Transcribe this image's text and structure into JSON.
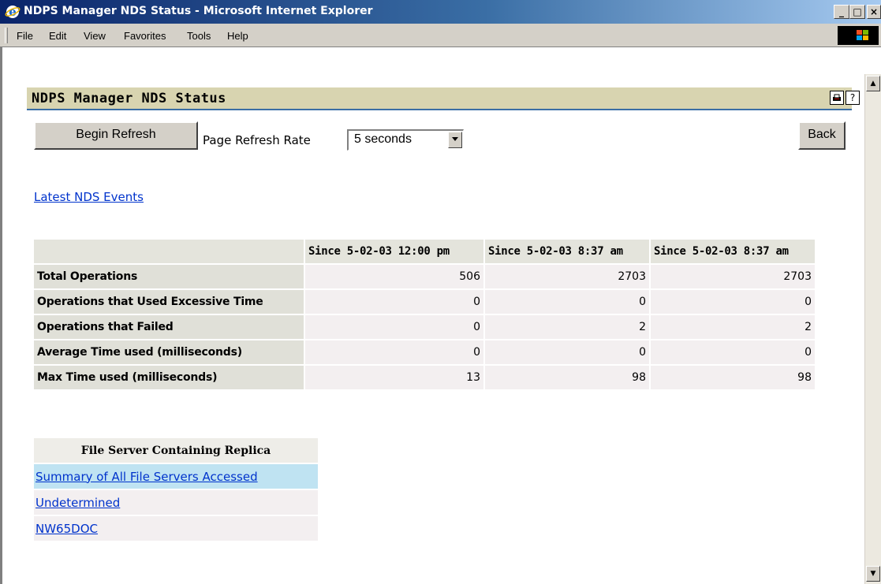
{
  "window": {
    "title": "NDPS Manager NDS Status - Microsoft Internet Explorer",
    "controls": {
      "minimize": "_",
      "maximize": "□",
      "close": "×"
    }
  },
  "menu": {
    "items": [
      "File",
      "Edit",
      "View",
      "Favorites",
      "Tools",
      "Help"
    ]
  },
  "header": {
    "title": "NDPS Manager NDS Status",
    "print_icon": "printer-icon",
    "help_icon": "help-icon"
  },
  "controls": {
    "begin_refresh": "Begin Refresh",
    "refresh_rate_label": "Page Refresh Rate",
    "refresh_rate_value": "5 seconds",
    "back": "Back"
  },
  "latest_link": "Latest NDS Events",
  "stats_table": {
    "columns": [
      "Since 5-02-03 12:00 pm",
      "Since 5-02-03 8:37 am",
      "Since 5-02-03 8:37 am"
    ],
    "rows": [
      {
        "label": "Total Operations",
        "values": [
          "506",
          "2703",
          "2703"
        ]
      },
      {
        "label": "Operations that Used Excessive Time",
        "values": [
          "0",
          "0",
          "0"
        ]
      },
      {
        "label": "Operations that Failed",
        "values": [
          "0",
          "2",
          "2"
        ]
      },
      {
        "label": "Average Time used (milliseconds)",
        "values": [
          "0",
          "0",
          "0"
        ]
      },
      {
        "label": "Max Time used (milliseconds)",
        "values": [
          "13",
          "98",
          "98"
        ]
      }
    ]
  },
  "servers_table": {
    "header": "File Server Containing Replica",
    "rows": [
      "Summary of All File Servers Accessed",
      "Undetermined",
      "NW65DOC"
    ]
  },
  "colors": {
    "title_bar": "#0a246a",
    "header_band": "#d8d4b0",
    "link": "#0033cc",
    "active_row": "#bfe3f2"
  }
}
